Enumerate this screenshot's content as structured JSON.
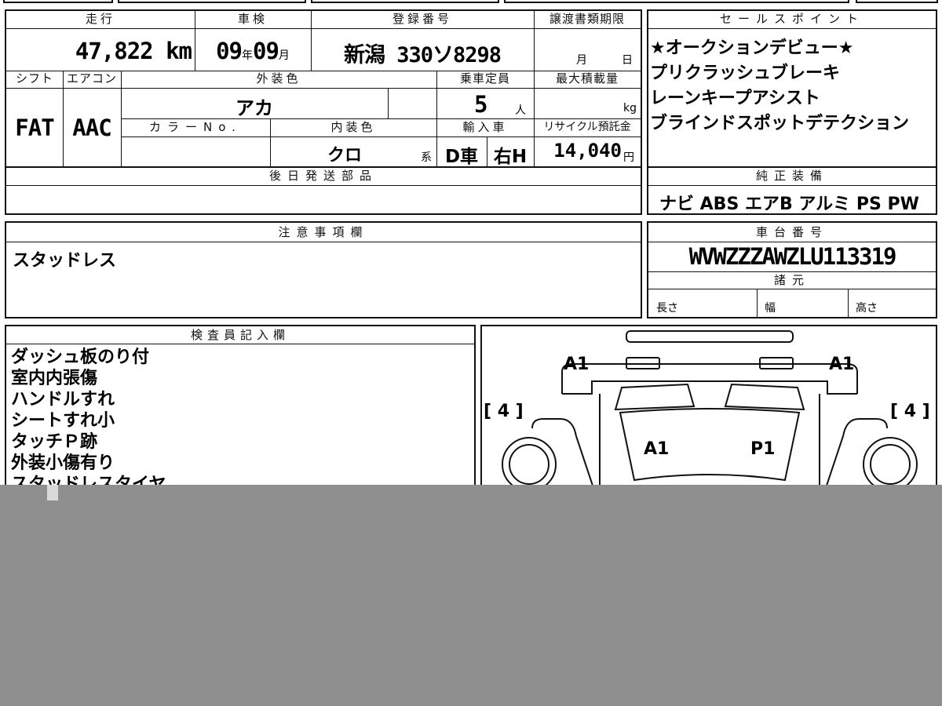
{
  "top": {
    "header_labels": {
      "mileage": "走行",
      "inspection": "車検",
      "registration": "登録番号",
      "transfer_deadline": "譲渡書類期限",
      "shift": "シフト",
      "aircon": "エアコン",
      "exterior_color": "外装色",
      "capacity": "乗車定員",
      "max_load": "最大積載量",
      "color_no": "カラーNo.",
      "interior_color": "内装色",
      "import": "輸入車",
      "recycle": "リサイクル預託金",
      "later_parts": "後日発送部品",
      "notes": "注意事項欄",
      "inspector": "検査員記入欄",
      "sales_points": "セールスポイント",
      "genuine": "純正装備",
      "chassis": "車台番号",
      "specs": "諸元"
    },
    "mileage_value": "47,822 km",
    "inspection_year": "09",
    "inspection_year_unit": "年",
    "inspection_month": "09",
    "inspection_month_unit": "月",
    "registration_value": "新潟 330ソ8298",
    "transfer_month_unit": "月",
    "transfer_day_unit": "日",
    "shift_value": "FAT",
    "aircon_value": "AAC",
    "exterior_value": "アカ",
    "capacity_value": "5",
    "capacity_unit": "人",
    "max_load_unit": "kg",
    "interior_value": "クロ",
    "interior_suffix": "系",
    "import_value_1": "D車",
    "import_value_2": "右H",
    "recycle_value": "14,040",
    "recycle_unit": "円"
  },
  "sales_points": [
    "★オークションデビュー★",
    "プリクラッシュブレーキ",
    "レーンキープアシスト",
    "ブラインドスポットデテクション"
  ],
  "genuine_equipment": "ナビ ABS エアB アルミ PS PW",
  "notes_value": "スタッドレス",
  "chassis_number": "WVWZZZAWZLU113319",
  "specs_labels": {
    "length": "長さ",
    "width": "幅",
    "height": "高さ"
  },
  "inspector_notes": [
    "ダッシュ板のり付",
    "室内内張傷",
    "ハンドルすれ",
    "シートすれ小",
    "タッチＰ跡",
    "外装小傷有り",
    "スタッドレスタイヤ"
  ],
  "diagram": {
    "label_a1_left": "A1",
    "label_a1_right": "A1",
    "label_a1_center": "A1",
    "label_p1_center": "P1",
    "tire_left": "[ 4 ]",
    "tire_right": "[ 4 ]"
  }
}
